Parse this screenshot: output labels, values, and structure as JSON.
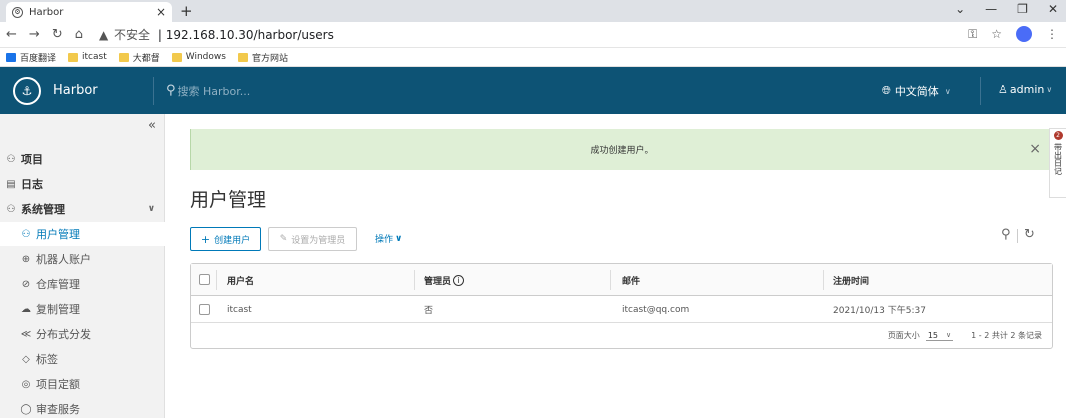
{
  "browser": {
    "tab_title": "Harbor",
    "tab_close": "×",
    "new_tab": "+",
    "url_insecure": "不安全",
    "url": "192.168.10.30/harbor/users",
    "bookmarks": [
      {
        "label": "百度翻译",
        "icon": "translate-icon"
      },
      {
        "label": "itcast",
        "icon": "folder-icon"
      },
      {
        "label": "大都督",
        "icon": "folder-icon"
      },
      {
        "label": "Windows",
        "icon": "folder-icon"
      },
      {
        "label": "官方网站",
        "icon": "folder-icon"
      }
    ]
  },
  "header": {
    "brand": "Harbor",
    "search_placeholder": "搜索 Harbor...",
    "language": "中文简体",
    "user": "admin"
  },
  "sidebar": {
    "collapse": "«",
    "items": [
      {
        "label": "项目",
        "icon": "projects-icon"
      },
      {
        "label": "日志",
        "icon": "logs-icon"
      },
      {
        "label": "系统管理",
        "icon": "admin-icon"
      }
    ],
    "sub_items": [
      {
        "label": "用户管理",
        "icon": "users-icon",
        "active": true
      },
      {
        "label": "机器人账户",
        "icon": "robot-icon"
      },
      {
        "label": "仓库管理",
        "icon": "registry-icon"
      },
      {
        "label": "复制管理",
        "icon": "replication-icon"
      },
      {
        "label": "分布式分发",
        "icon": "distribution-icon"
      },
      {
        "label": "标签",
        "icon": "tag-icon"
      },
      {
        "label": "项目定额",
        "icon": "quota-icon"
      },
      {
        "label": "审查服务",
        "icon": "scanner-icon"
      }
    ]
  },
  "alert": {
    "message": "成功创建用户。",
    "close": "×"
  },
  "main": {
    "title": "用户管理",
    "new_user": "创建用户",
    "set_admin": "设置为管理员",
    "actions": "操作",
    "columns": [
      "用户名",
      "管理员",
      "邮件",
      "注册时间"
    ],
    "rows": [
      {
        "username": "itcast",
        "admin": "否",
        "email": "itcast@qq.com",
        "registered": "2021/10/13 下午5:37"
      }
    ],
    "footer": {
      "page_size_label": "页面大小",
      "page_size": "15",
      "summary": "1 - 2 共计 2 条记录"
    }
  },
  "side_widget": {
    "badge": "2",
    "text": "带出日记"
  }
}
